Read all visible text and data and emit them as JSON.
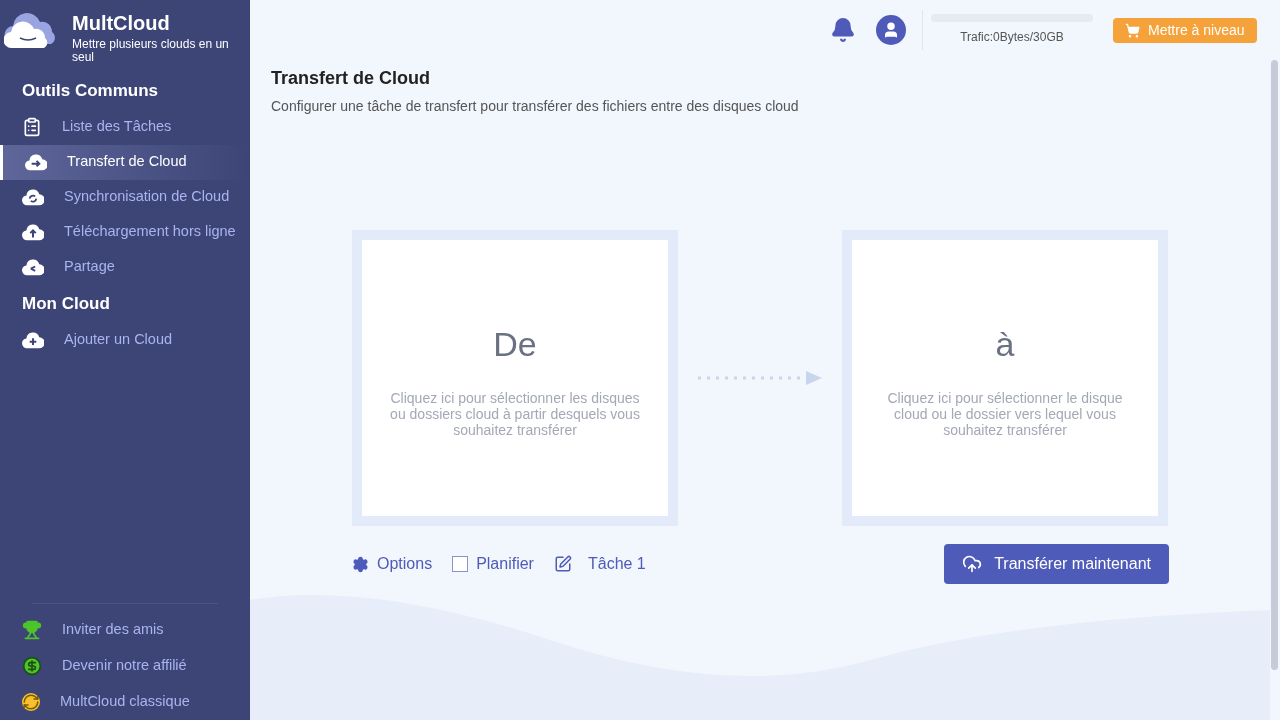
{
  "brand": {
    "name": "MultCloud",
    "tagline": "Mettre plusieurs clouds en un seul"
  },
  "sidebar": {
    "sections": [
      {
        "title": "Outils Communs",
        "items": [
          {
            "label": "Liste des Tâches",
            "selected": false
          },
          {
            "label": "Transfert de Cloud",
            "selected": true
          },
          {
            "label": "Synchronisation de Cloud",
            "selected": false
          },
          {
            "label": "Téléchargement hors ligne",
            "selected": false
          },
          {
            "label": "Partage",
            "selected": false
          }
        ]
      },
      {
        "title": "Mon Cloud",
        "items": [
          {
            "label": "Ajouter un Cloud",
            "selected": false
          }
        ]
      }
    ],
    "footer": [
      {
        "label": "Inviter des amis"
      },
      {
        "label": "Devenir notre affilié"
      },
      {
        "label": "MultCloud classique"
      }
    ]
  },
  "header": {
    "traffic": {
      "level": 0,
      "text": "Trafic:0Bytes/30GB"
    },
    "upgrade": "Mettre à niveau"
  },
  "page": {
    "title": "Transfert de Cloud",
    "subtitle": "Configurer une tâche de transfert pour transférer des fichiers entre des disques cloud"
  },
  "source": {
    "heading": "De",
    "hint": "Cliquez ici pour sélectionner les disques ou dossiers cloud à partir desquels vous souhaitez transférer"
  },
  "target": {
    "heading": "à",
    "hint": "Cliquez ici pour sélectionner le disque cloud ou le dossier vers lequel vous souhaitez transférer"
  },
  "options": {
    "options": "Options",
    "schedule": {
      "label": "Planifier",
      "checked": false
    },
    "task": "Tâche 1"
  },
  "transfer_button": "Transférer maintenant"
}
